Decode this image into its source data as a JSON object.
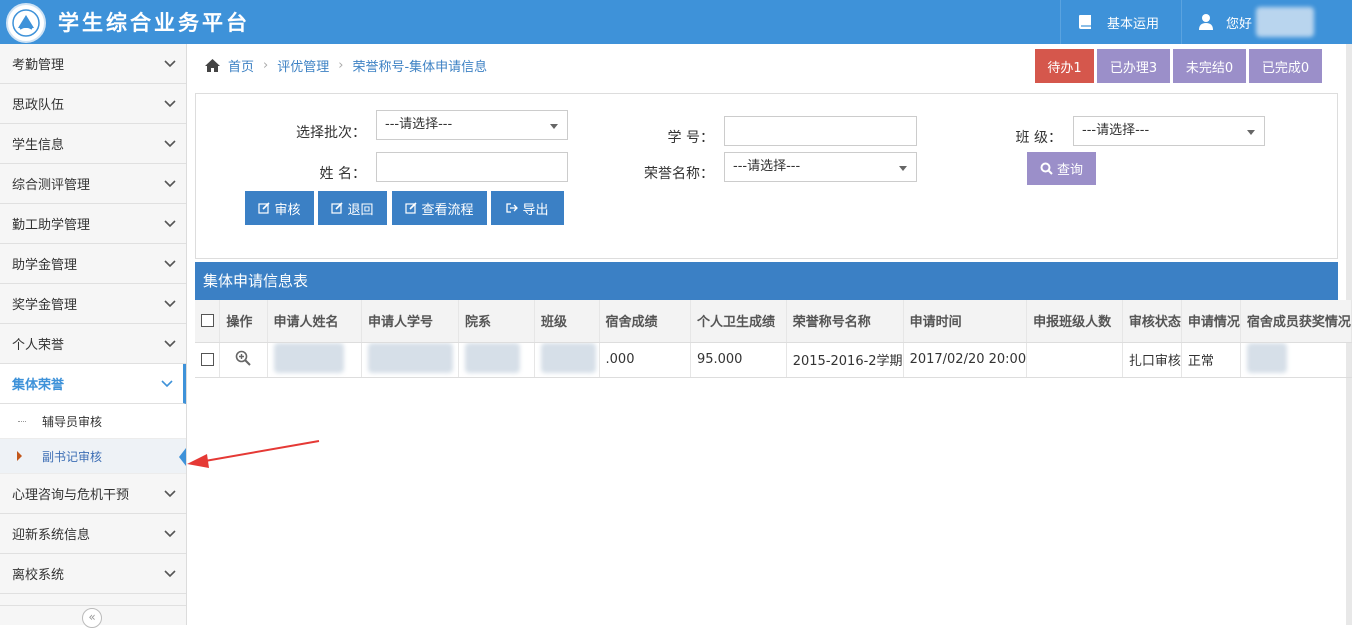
{
  "header": {
    "title": "学生综合业务平台",
    "basic_use": "基本运用",
    "greeting": "您好"
  },
  "sidebar": {
    "items": [
      "考勤管理",
      "思政队伍",
      "学生信息",
      "综合测评管理",
      "勤工助学管理",
      "助学金管理",
      "奖学金管理",
      "个人荣誉",
      "集体荣誉",
      "心理咨询与危机干预",
      "迎新系统信息",
      "离校系统"
    ],
    "active": "集体荣誉",
    "sub_items": [
      "辅导员审核",
      "副书记审核"
    ],
    "collapse": "«"
  },
  "breadcrumb": {
    "home": "首页",
    "level1": "评优管理",
    "level2": "荣誉称号-集体申请信息"
  },
  "status": {
    "todo": "待办1",
    "handled": "已办理3",
    "unfinished": "未完结0",
    "finished": "已完成0"
  },
  "colors": {
    "todo": "#d5574c",
    "handled": "#9b8fc9",
    "primary": "#3b80c5",
    "header": "#3e92d9"
  },
  "search": {
    "batch_label": "选择批次：",
    "batch_value": "---请选择---",
    "student_id_label": "学 号：",
    "class_label": "班 级：",
    "class_value": "---请选择---",
    "name_label": "姓 名：",
    "honor_label": "荣誉名称：",
    "honor_value": "---请选择---",
    "query_btn": "查询"
  },
  "actions": {
    "review": "审核",
    "return": "退回",
    "view_flow": "查看流程",
    "export": "导出"
  },
  "table": {
    "title": "集体申请信息表",
    "headers": [
      "操作",
      "申请人姓名",
      "申请人学号",
      "院系",
      "班级",
      "宿舍成绩",
      "个人卫生成绩",
      "荣誉称号名称",
      "申请时间",
      "申报班级人数",
      "审核状态",
      "申请情况",
      "宿舍成员获奖情况"
    ],
    "rows": [
      {
        "dorm_score": ".000",
        "hygiene_score": "95.000",
        "honor_name": "2015-2016-2学期",
        "apply_time": "2017/02/20 20:00",
        "class_count": "",
        "review_status": "扎口审核",
        "apply_status": "正常"
      }
    ]
  }
}
